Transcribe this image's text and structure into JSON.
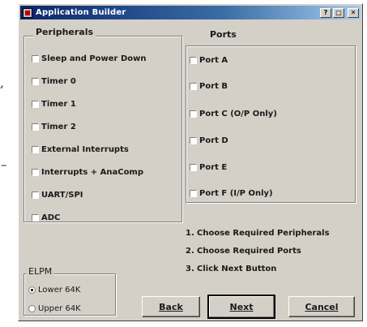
{
  "stray_marks": {
    "comma": ",",
    "dash": "–"
  },
  "window": {
    "title": "Application Builder",
    "buttons": {
      "help": "?",
      "maximize": "□",
      "close": "✕"
    }
  },
  "peripherals": {
    "label": "Peripherals",
    "items": [
      {
        "label": "Sleep and Power Down",
        "checked": false
      },
      {
        "label": "Timer 0",
        "checked": false
      },
      {
        "label": "Timer 1",
        "checked": false
      },
      {
        "label": "Timer 2",
        "checked": false
      },
      {
        "label": "External Interrupts",
        "checked": false
      },
      {
        "label": "Interrupts + AnaComp",
        "checked": false
      },
      {
        "label": "UART/SPI",
        "checked": false
      },
      {
        "label": "ADC",
        "checked": false
      }
    ]
  },
  "ports": {
    "label": "Ports",
    "items": [
      {
        "label": "Port A",
        "checked": false
      },
      {
        "label": "Port B",
        "checked": false
      },
      {
        "label": "Port C (O/P Only)",
        "checked": false
      },
      {
        "label": "Port D",
        "checked": false
      },
      {
        "label": "Port E",
        "checked": false
      },
      {
        "label": "Port F (I/P Only)",
        "checked": false
      }
    ]
  },
  "elpm": {
    "label": "ELPM",
    "options": [
      {
        "label": "Lower 64K",
        "selected": true
      },
      {
        "label": "Upper 64K",
        "selected": false
      }
    ]
  },
  "instructions": [
    {
      "num": "1.",
      "text": "Choose Required Peripherals"
    },
    {
      "num": "2.",
      "text": "Choose Required Ports"
    },
    {
      "num": "3.",
      "text": "Click Next Button"
    }
  ],
  "buttons": {
    "back": "Back",
    "next": "Next",
    "cancel": "Cancel"
  }
}
